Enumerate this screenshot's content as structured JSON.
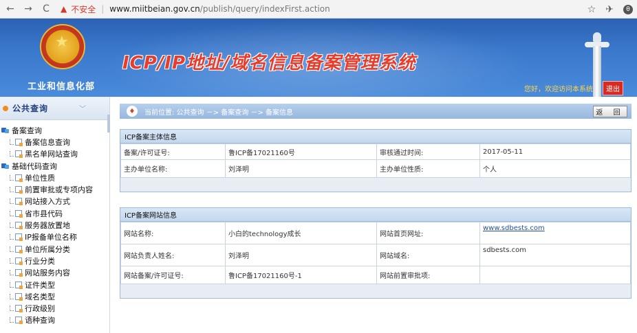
{
  "browser": {
    "insecure_label": "不安全",
    "url_host": "www.miitbeian.gov.cn",
    "url_path": "/publish/query/indexFirst.action",
    "avatar_letter": "θ"
  },
  "header": {
    "ministry": "工业和信息化部",
    "system_title": "ICP/IP地址/域名信息备案管理系统",
    "welcome": "您好，欢迎访问本系统",
    "logout": "退出"
  },
  "sidebar": {
    "title": "公共查询",
    "items": [
      {
        "label": "备案查询",
        "level": 0
      },
      {
        "label": "备案信息查询",
        "level": 1
      },
      {
        "label": "黑名单网站查询",
        "level": 1
      },
      {
        "label": "基础代码查询",
        "level": 0
      },
      {
        "label": "单位性质",
        "level": 1
      },
      {
        "label": "前置审批或专项内容",
        "level": 1
      },
      {
        "label": "网站接入方式",
        "level": 1
      },
      {
        "label": "省市县代码",
        "level": 1
      },
      {
        "label": "服务器放置地",
        "level": 1
      },
      {
        "label": "IP报备单位名称",
        "level": 1
      },
      {
        "label": "单位所属分类",
        "level": 1
      },
      {
        "label": "行业分类",
        "level": 1
      },
      {
        "label": "网站服务内容",
        "level": 1
      },
      {
        "label": "证件类型",
        "level": 1
      },
      {
        "label": "域名类型",
        "level": 1
      },
      {
        "label": "行政级别",
        "level": 1
      },
      {
        "label": "语种查询",
        "level": 1
      }
    ]
  },
  "breadcrumb": "当前位置: 公共查询 －> 备案查询 －> 备案信息",
  "back_button": "返 回",
  "subject_panel": {
    "title": "ICP备案主体信息",
    "rows": [
      [
        "备案/许可证号:",
        "鲁ICP备17021160号",
        "审核通过时间:",
        "2017-05-11"
      ],
      [
        "主办单位名称:",
        "刘泽明",
        "主办单位性质:",
        "个人"
      ]
    ]
  },
  "site_panel": {
    "title": "ICP备案网站信息",
    "rows": [
      [
        "网站名称:",
        "小白的technology成长",
        "网站首页网址:",
        "www.sdbests.com"
      ],
      [
        "网站负责人姓名:",
        "刘泽明",
        "网站域名:",
        "sdbests.com"
      ],
      [
        "网站备案/许可证号:",
        "鲁ICP备17021160号-1",
        "网站前置审批项:",
        ""
      ]
    ]
  }
}
